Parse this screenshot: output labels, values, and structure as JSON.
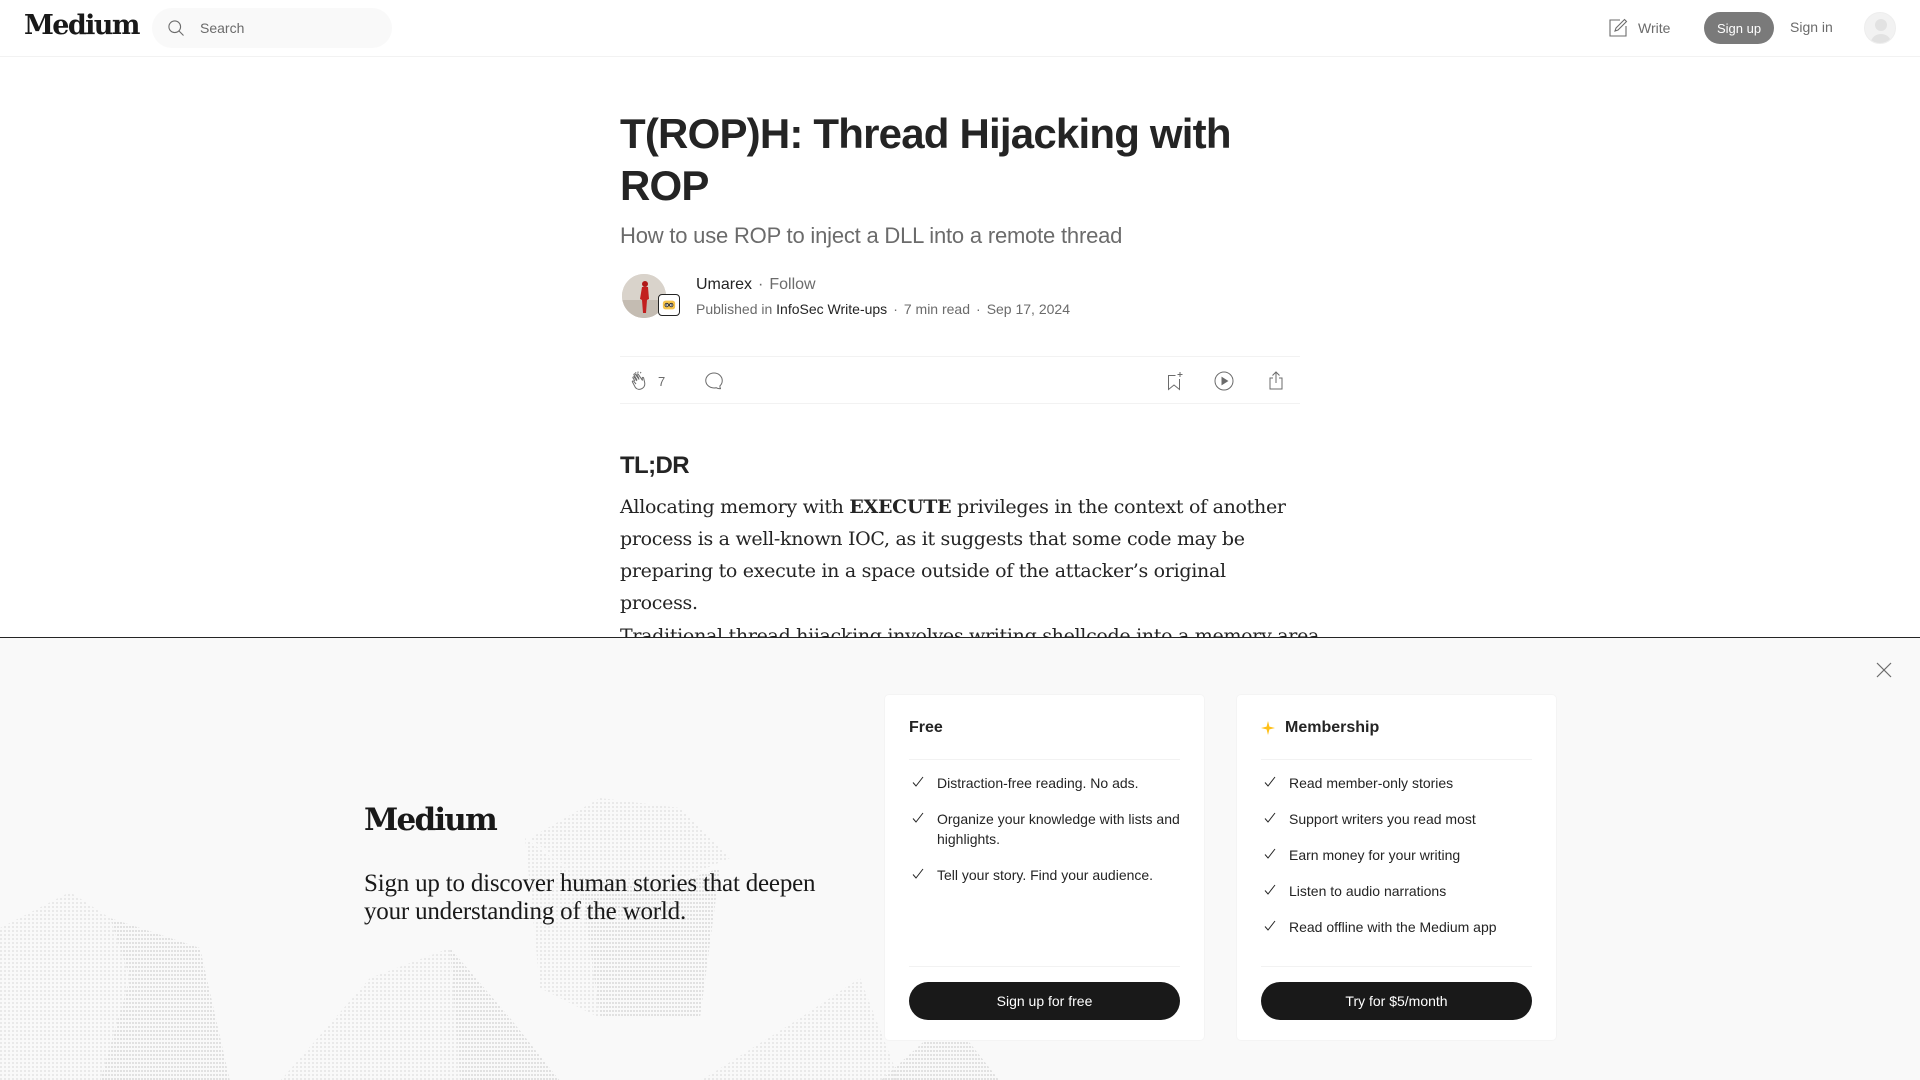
{
  "header": {
    "logo": "Medium",
    "search_placeholder": "Search",
    "write_label": "Write",
    "signup_label": "Sign up",
    "signin_label": "Sign in"
  },
  "article": {
    "title": "T(ROP)H: Thread Hijacking with ROP",
    "subtitle": "How to use ROP to inject a DLL into a remote thread",
    "author": {
      "name": "Umarex",
      "follow_label": "Follow",
      "published_in_label": "Published in",
      "publication": "InfoSec Write-ups",
      "read_time": "7 min read",
      "date": "Sep 17, 2024"
    },
    "actions": {
      "clap_count": "7"
    },
    "section_heading": "TL;DR",
    "paragraph1": {
      "before": "Allocating memory with ",
      "bold": "EXECUTE",
      "after": " privileges in the context of another process is a well-known IOC, as it suggests that some code may be preparing to execute in a space outside of the attacker’s original process."
    },
    "paragraph2_partial": "Traditional thread hijacking involves writing shellcode into a memory area"
  },
  "signup_overlay": {
    "logo": "Medium",
    "tagline": "Sign up to discover human stories that deepen your understanding of the world.",
    "plans": [
      {
        "name": "Free",
        "features": [
          "Distraction-free reading. No ads.",
          "Organize your knowledge with lists and highlights.",
          "Tell your story. Find your audience."
        ],
        "button_label": "Sign up for free"
      },
      {
        "name": "Membership",
        "accent_color": "#ffc017",
        "features": [
          "Read member-only stories",
          "Support writers you read most",
          "Earn money for your writing",
          "Listen to audio narrations",
          "Read offline with the Medium app"
        ],
        "button_label": "Try for $5/month"
      }
    ]
  }
}
